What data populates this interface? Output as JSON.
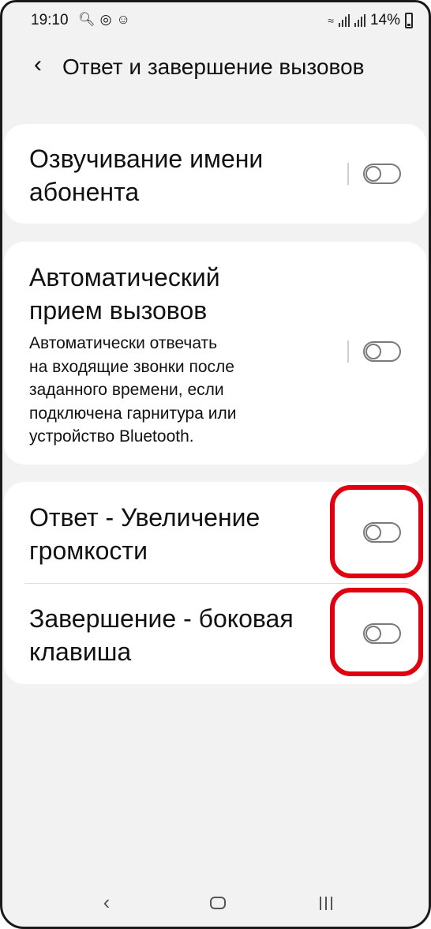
{
  "status_bar": {
    "time": "19:10",
    "left_icons": [
      "search-icon",
      "sync-icon",
      "notification-icon"
    ],
    "battery": "14%"
  },
  "header": {
    "back_icon": "chevron-left-icon",
    "title": "Ответ и завершение вызовов"
  },
  "settings": [
    {
      "id": "caller-name-announce",
      "title_lines": [
        "Озвучивание имени",
        "абонента"
      ],
      "enabled": false
    },
    {
      "id": "auto-answer",
      "title_lines": [
        "Автоматический",
        "прием вызовов"
      ],
      "description_lines": [
        "Автоматически отвечать",
        "на входящие звонки после",
        "заданного времени, если",
        "подключена гарнитура или",
        "устройство Bluetooth."
      ],
      "enabled": false
    },
    {
      "id": "answer-volume-up",
      "title_lines": [
        "Ответ - Увеличение",
        "громкости"
      ],
      "enabled": false,
      "highlighted": true
    },
    {
      "id": "end-side-key",
      "title_lines": [
        "Завершение - боковая",
        "клавиша"
      ],
      "enabled": false,
      "highlighted": true
    }
  ],
  "highlight_color": "#e00010",
  "nav_bar": {
    "icons": [
      "back-icon",
      "home-icon",
      "recent-apps-icon"
    ]
  }
}
